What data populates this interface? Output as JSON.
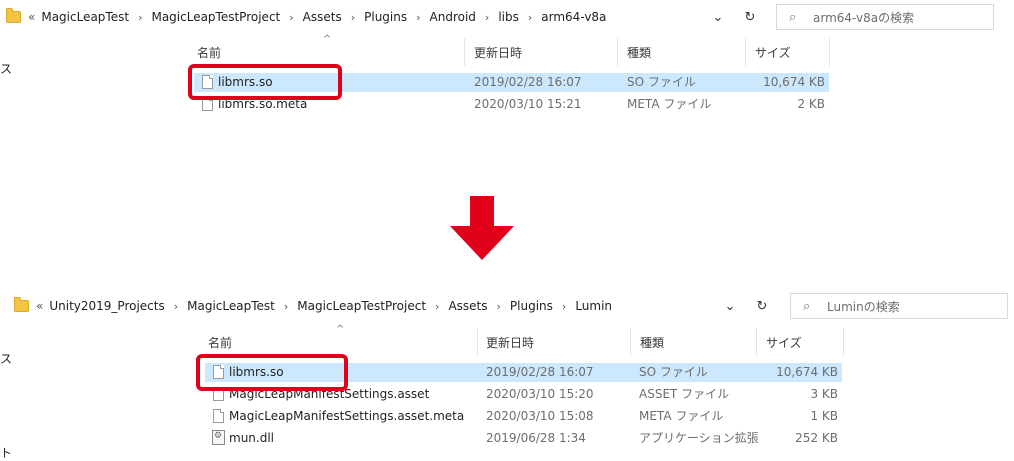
{
  "top": {
    "breadcrumb_prefix": "«",
    "breadcrumb": [
      "MagicLeapTest",
      "MagicLeapTestProject",
      "Assets",
      "Plugins",
      "Android",
      "libs",
      "arm64-v8a"
    ],
    "separator": "›",
    "dropdown": "⌄",
    "refresh": "↻",
    "search_placeholder": "arm64-v8aの検索",
    "headers": {
      "name": "名前",
      "date": "更新日時",
      "type": "種類",
      "size": "サイズ"
    },
    "sort_caret": "^",
    "side_text": "ス",
    "rows": [
      {
        "name": "libmrs.so",
        "date": "2019/02/28 16:07",
        "type": "SO ファイル",
        "size": "10,674 KB",
        "selected": true
      },
      {
        "name": "libmrs.so.meta",
        "date": "2020/03/10 15:21",
        "type": "META ファイル",
        "size": "2 KB",
        "selected": false
      }
    ]
  },
  "bottom": {
    "breadcrumb_prefix": "«",
    "breadcrumb": [
      "Unity2019_Projects",
      "MagicLeapTest",
      "MagicLeapTestProject",
      "Assets",
      "Plugins",
      "Lumin"
    ],
    "separator": "›",
    "dropdown": "⌄",
    "refresh": "↻",
    "search_placeholder": "Luminの検索",
    "headers": {
      "name": "名前",
      "date": "更新日時",
      "type": "種類",
      "size": "サイズ"
    },
    "sort_caret": "^",
    "side_text": "ス",
    "side_text2": "ト",
    "rows": [
      {
        "name": "libmrs.so",
        "date": "2019/02/28 16:07",
        "type": "SO ファイル",
        "size": "10,674 KB",
        "selected": true,
        "icon": "file"
      },
      {
        "name": "MagicLeapManifestSettings.asset",
        "date": "2020/03/10 15:20",
        "type": "ASSET ファイル",
        "size": "3 KB",
        "selected": false,
        "icon": "file"
      },
      {
        "name": "MagicLeapManifestSettings.asset.meta",
        "date": "2020/03/10 15:08",
        "type": "META ファイル",
        "size": "1 KB",
        "selected": false,
        "icon": "file"
      },
      {
        "name": "mun.dll",
        "date": "2019/06/28 1:34",
        "type": "アプリケーション拡張",
        "size": "252 KB",
        "selected": false,
        "icon": "dll"
      }
    ]
  },
  "colors": {
    "selection": "#cce8ff",
    "highlight": "#e0001a",
    "arrow": "#e0001a"
  }
}
